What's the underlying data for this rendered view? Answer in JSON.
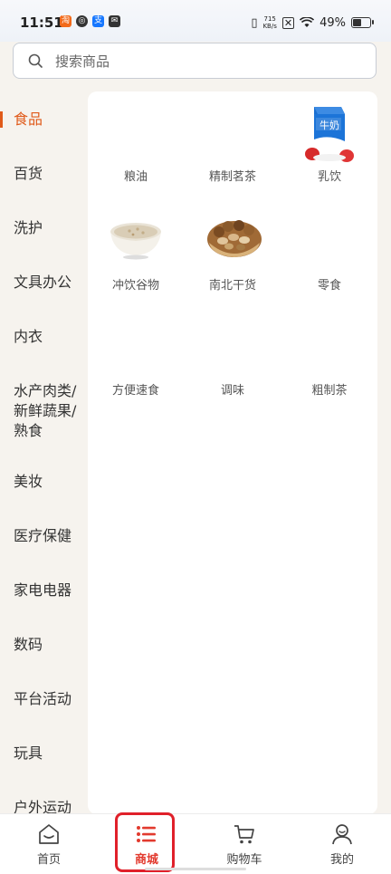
{
  "status_bar": {
    "time": "11:51",
    "net_speed_value": "715",
    "net_speed_unit": "KB/s",
    "battery": "49%"
  },
  "search": {
    "placeholder": "搜索商品",
    "icon": "search-icon"
  },
  "sidebar": {
    "items": [
      {
        "label": "食品",
        "active": true
      },
      {
        "label": "百货"
      },
      {
        "label": "洗护"
      },
      {
        "label": "文具办公"
      },
      {
        "label": "内衣"
      },
      {
        "label": "水产肉类/新鲜蔬果/熟食"
      },
      {
        "label": "美妆"
      },
      {
        "label": "医疗保健"
      },
      {
        "label": "家电电器"
      },
      {
        "label": "数码"
      },
      {
        "label": "平台活动"
      },
      {
        "label": "玩具"
      },
      {
        "label": "户外运动"
      }
    ]
  },
  "subcategories": [
    {
      "label": "粮油"
    },
    {
      "label": "精制茗茶"
    },
    {
      "label": "乳饮",
      "image": "milk-carton",
      "image_text": "牛奶"
    },
    {
      "label": "冲饮谷物",
      "image": "oatmeal-bowl"
    },
    {
      "label": "南北干货",
      "image": "nuts-basket"
    },
    {
      "label": "零食"
    },
    {
      "label": "方便速食"
    },
    {
      "label": "调味"
    },
    {
      "label": "粗制茶"
    }
  ],
  "bottom_nav": {
    "tabs": [
      {
        "label": "首页",
        "icon": "home-icon"
      },
      {
        "label": "商城",
        "icon": "list-icon",
        "active": true
      },
      {
        "label": "购物车",
        "icon": "cart-icon"
      },
      {
        "label": "我的",
        "icon": "user-icon"
      }
    ]
  },
  "colors": {
    "accent": "#e05a1a",
    "active_tab": "#e23a2e",
    "highlight_box": "#e0202a"
  }
}
